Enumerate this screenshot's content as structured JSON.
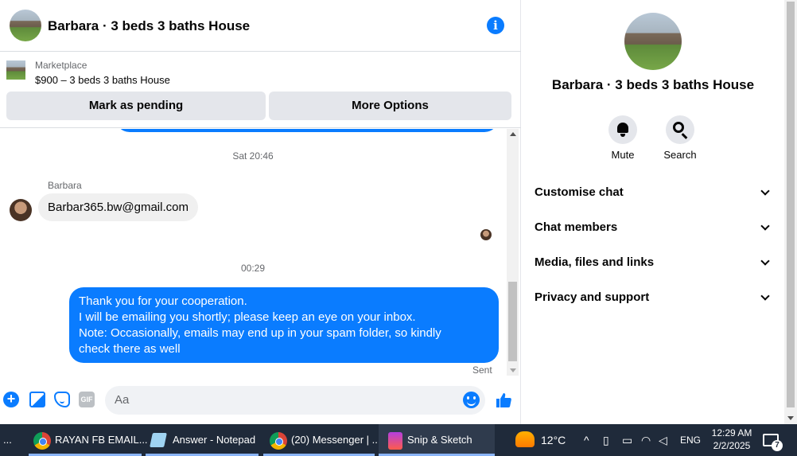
{
  "header": {
    "title": "Barbara · 3 beds 3 baths House",
    "info_icon": "info-icon"
  },
  "marketplace": {
    "label": "Marketplace",
    "listing": "$900 – 3 beds 3 baths House",
    "mark_pending_label": "Mark as pending",
    "more_options_label": "More Options"
  },
  "messages": {
    "timestamp_1": "Sat 20:46",
    "sender_name": "Barbara",
    "incoming_text": "Barbar365.bw@gmail.com",
    "timestamp_2": "00:29",
    "outgoing_lines": [
      "Thank you for your cooperation.",
      "I will be emailing you shortly; please keep an eye on your inbox.",
      "Note: Occasionally, emails may end up in your spam folder, so kindly",
      "check there as well"
    ],
    "status": "Sent"
  },
  "composer": {
    "placeholder": "Aa",
    "gif_label": "GIF"
  },
  "panel": {
    "title": "Barbara · 3 beds 3 baths House",
    "actions": [
      {
        "label": "Mute",
        "icon": "bell-icon"
      },
      {
        "label": "Search",
        "icon": "search-icon"
      }
    ],
    "sections": [
      "Customise chat",
      "Chat members",
      "Media, files and links",
      "Privacy and support"
    ]
  },
  "taskbar": {
    "tasks": [
      "...",
      "RAYAN FB EMAIL...",
      "Answer - Notepad",
      "(20) Messenger | ...",
      "Snip & Sketch"
    ],
    "weather": "12°C",
    "language": "ENG",
    "time": "12:29 AM",
    "date": "2/2/2025",
    "notification_count": "7"
  },
  "colors": {
    "accent": "#0a7cff",
    "bubble_in": "#f0f0f0",
    "button_gray": "#e4e6eb",
    "taskbar": "#1f2a3a"
  }
}
